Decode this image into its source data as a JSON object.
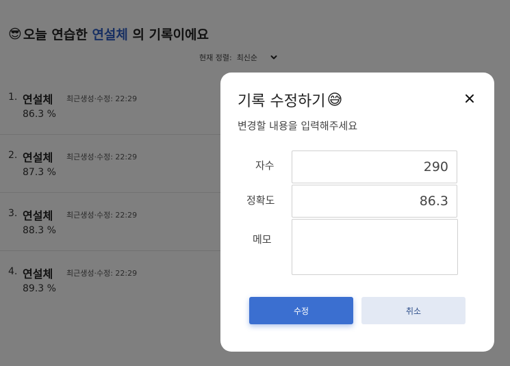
{
  "page": {
    "title_emoji": "😎",
    "title_prefix": "오늘 연습한 ",
    "title_highlight": "연설체",
    "title_suffix": " 의 기록이에요",
    "sort_label": "현재 정렬:",
    "sort_value": "최신순"
  },
  "records": [
    {
      "index": "1.",
      "name": "연설체",
      "meta": "최근생성·수정: 22:29",
      "accuracy": "86.3 %"
    },
    {
      "index": "2.",
      "name": "연설체",
      "meta": "최근생성·수정: 22:29",
      "accuracy": "87.3 %"
    },
    {
      "index": "3.",
      "name": "연설체",
      "meta": "최근생성·수정: 22:29",
      "accuracy": "88.3 %"
    },
    {
      "index": "4.",
      "name": "연설체",
      "meta": "최근생성·수정: 22:29",
      "accuracy": "89.3 %"
    }
  ],
  "modal": {
    "title": "기록 수정하기",
    "title_emoji": "😅",
    "subtitle": "변경할 내용을 입력해주세요",
    "fields": {
      "chars_label": "자수",
      "chars_value": "290",
      "accuracy_label": "정확도",
      "accuracy_value": "86.3",
      "memo_label": "메모",
      "memo_value": ""
    },
    "confirm_label": "수정",
    "cancel_label": "취소"
  },
  "colors": {
    "accent": "#3b6fd0",
    "highlight_text": "#2f5fc4",
    "secondary_button_bg": "#e3e9f4",
    "overlay": "rgba(0,0,0,0.5)"
  },
  "icons": {
    "title_icon": "sunglasses-emoji",
    "modal_title_icon": "sweat-smile-emoji",
    "close": "close-icon",
    "sort": "chevron-down-icon"
  }
}
